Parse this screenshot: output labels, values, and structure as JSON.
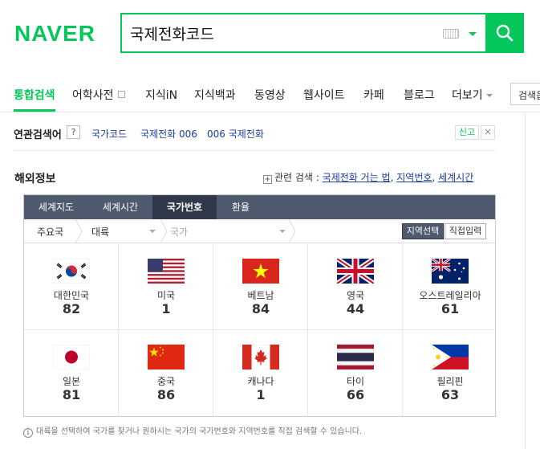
{
  "header": {
    "logo": "NAVER",
    "search_value": "국제전화코드"
  },
  "tabs": [
    {
      "label": "통합검색"
    },
    {
      "label": "어학사전"
    },
    {
      "label": "지식iN"
    },
    {
      "label": "지식백과"
    },
    {
      "label": "동영상"
    },
    {
      "label": "웹사이트"
    },
    {
      "label": "카페"
    },
    {
      "label": "블로그"
    },
    {
      "label": "더보기"
    }
  ],
  "right_button": "검색옵션",
  "related": {
    "title": "연관검색어",
    "help": "?",
    "links": [
      "국가코드",
      "국제전화 006",
      "006 국제전화"
    ],
    "report": "신고",
    "close": "×"
  },
  "section": {
    "title": "해외정보",
    "related_prefix": "관련 검색 :",
    "related_links": [
      "국제전화 거는 법",
      "지역번호",
      "세계시간"
    ],
    "sep": ","
  },
  "box": {
    "tabs": [
      "세계지도",
      "세계시간",
      "국가번호",
      "환율"
    ],
    "selector": {
      "main": "주요국",
      "continent": "대륙",
      "country": "국가"
    },
    "region_button": "지역선택",
    "direct_button": "직접입력",
    "countries": [
      {
        "name": "대한민국",
        "code": "82",
        "flag": "korea-flag"
      },
      {
        "name": "미국",
        "code": "1",
        "flag": "usa-flag"
      },
      {
        "name": "베트남",
        "code": "84",
        "flag": "vietnam-flag"
      },
      {
        "name": "영국",
        "code": "44",
        "flag": "uk-flag"
      },
      {
        "name": "오스트레일리아",
        "code": "61",
        "flag": "australia-flag"
      },
      {
        "name": "일본",
        "code": "81",
        "flag": "japan-flag"
      },
      {
        "name": "중국",
        "code": "86",
        "flag": "china-flag"
      },
      {
        "name": "캐나다",
        "code": "1",
        "flag": "canada-flag"
      },
      {
        "name": "타이",
        "code": "66",
        "flag": "thailand-flag"
      },
      {
        "name": "필리핀",
        "code": "63",
        "flag": "philippines-flag"
      }
    ]
  },
  "footnote": "대륙을 선택하여 국가를 찾거나 원하시는 국가의 국가번호와 지역번호를 직접 검색할 수 있습니다.",
  "colors": {
    "brand": "#03c75a",
    "link": "#1a3d9e",
    "box_header": "#4f5a6e",
    "box_header_active": "#2f394a"
  }
}
